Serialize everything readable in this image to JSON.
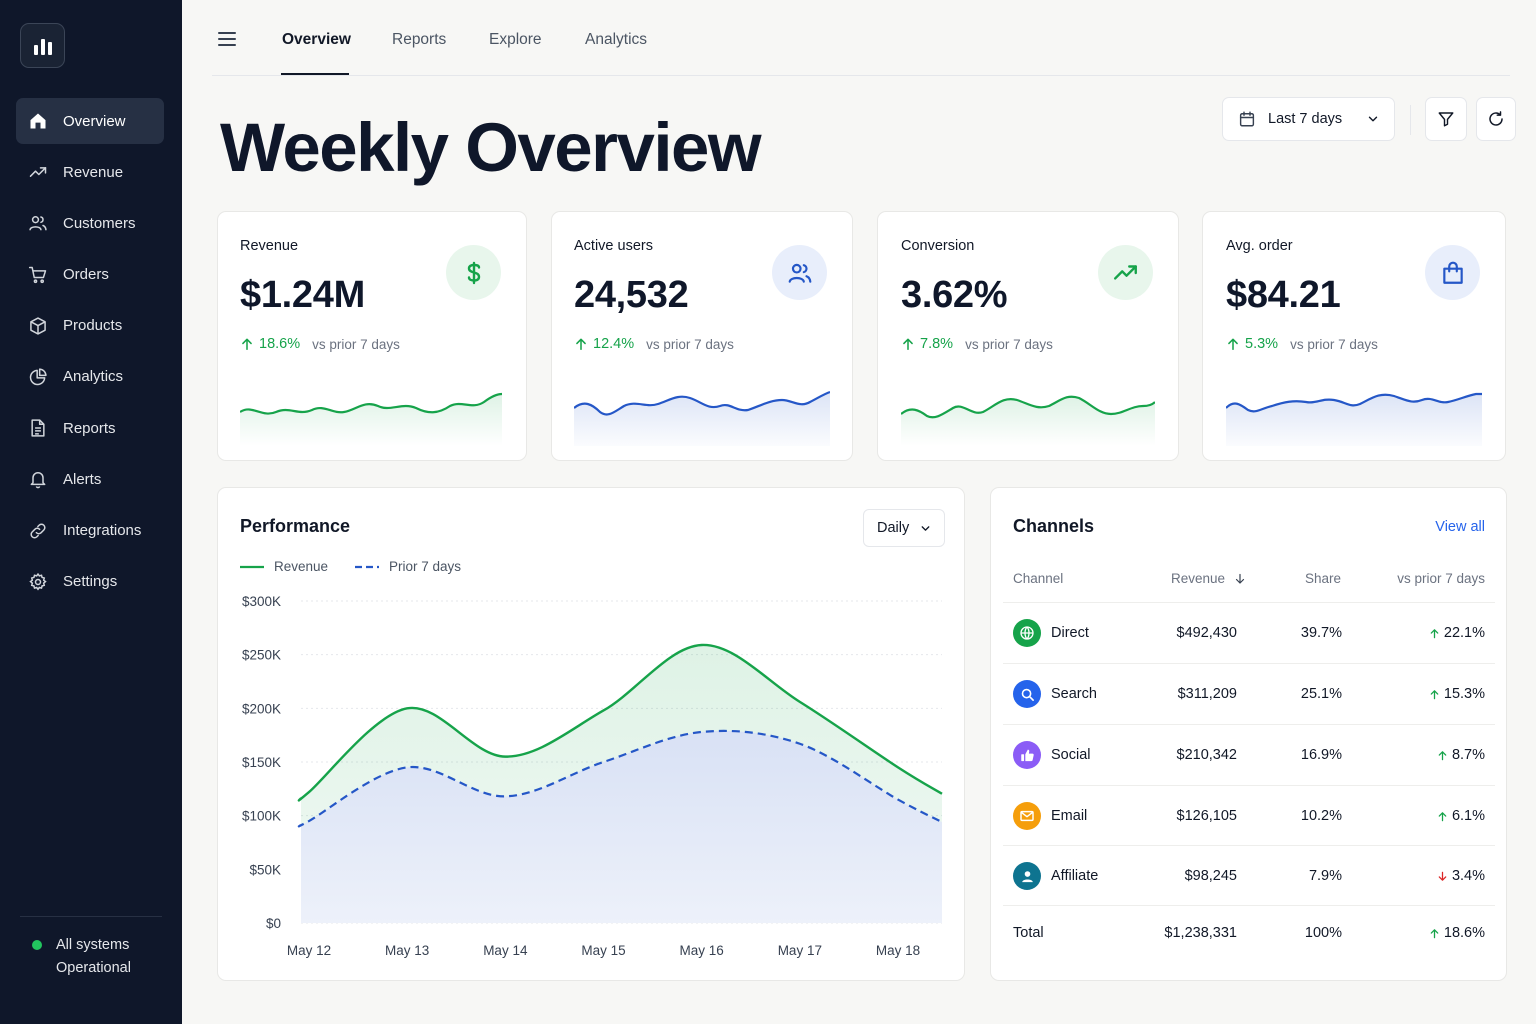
{
  "sidebar": {
    "logo_icon": "bar-chart-icon",
    "items": [
      {
        "label": "Overview",
        "icon": "home-icon",
        "active": true
      },
      {
        "label": "Revenue",
        "icon": "trending-up-icon"
      },
      {
        "label": "Customers",
        "icon": "users-icon"
      },
      {
        "label": "Orders",
        "icon": "cart-icon"
      },
      {
        "label": "Products",
        "icon": "box-icon"
      },
      {
        "label": "Analytics",
        "icon": "pie-chart-icon"
      },
      {
        "label": "Reports",
        "icon": "document-icon"
      },
      {
        "label": "Alerts",
        "icon": "bell-icon"
      },
      {
        "label": "Integrations",
        "icon": "link-icon"
      },
      {
        "label": "Settings",
        "icon": "gear-icon"
      }
    ],
    "status_line1": "All systems",
    "status_line2": "Operational",
    "status_color": "#22c55e"
  },
  "topnav": {
    "tabs": [
      {
        "label": "Overview",
        "active": true
      },
      {
        "label": "Reports"
      },
      {
        "label": "Explore"
      },
      {
        "label": "Analytics"
      }
    ]
  },
  "header": {
    "title": "Weekly Overview",
    "date_range": "Last 7 days"
  },
  "kpis": [
    {
      "label": "Revenue",
      "value": "$1.24M",
      "change": "18.6%",
      "comparison": "vs prior 7 days",
      "icon": "dollar-icon",
      "color": "#16a34a"
    },
    {
      "label": "Active users",
      "value": "24,532",
      "change": "12.4%",
      "comparison": "vs prior 7 days",
      "icon": "users-icon",
      "color": "#2557c7"
    },
    {
      "label": "Conversion",
      "value": "3.62%",
      "change": "7.8%",
      "comparison": "vs prior 7 days",
      "icon": "trending-up-icon",
      "color": "#16a34a"
    },
    {
      "label": "Avg. order",
      "value": "$84.21",
      "change": "5.3%",
      "comparison": "vs prior 7 days",
      "icon": "shopping-bag-icon",
      "color": "#2557c7"
    }
  ],
  "performance": {
    "title": "Performance",
    "granularity": "Daily",
    "legend_current": "Revenue",
    "legend_prior": "Prior 7 days"
  },
  "chart_data": {
    "type": "line",
    "x": [
      "May 12",
      "May 13",
      "May 14",
      "May 15",
      "May 16",
      "May 17",
      "May 18"
    ],
    "ytick_labels": [
      "$300K",
      "$250K",
      "$200K",
      "$150K",
      "$100K",
      "$50K",
      "$0"
    ],
    "ylim": [
      0,
      300000
    ],
    "series": [
      {
        "name": "Revenue",
        "color": "#16a34a",
        "style": "solid",
        "values": [
          122000,
          200000,
          155000,
          198000,
          259000,
          206000,
          145000
        ]
      },
      {
        "name": "Prior 7 days",
        "color": "#2557c7",
        "style": "dashed",
        "values": [
          95000,
          145000,
          118000,
          150000,
          178000,
          167000,
          115000
        ]
      }
    ],
    "grid": true,
    "legend": "top-left"
  },
  "channels": {
    "title": "Channels",
    "view_all": "View all",
    "columns": [
      "Channel",
      "Revenue",
      "Share",
      "vs prior 7 days"
    ],
    "rows": [
      {
        "name": "Direct",
        "revenue": "$492,430",
        "share": "39.7%",
        "change": "22.1%",
        "direction": "up",
        "icon": "globe-icon",
        "color": "#16a34a"
      },
      {
        "name": "Search",
        "revenue": "$311,209",
        "share": "25.1%",
        "change": "15.3%",
        "direction": "up",
        "icon": "search-icon",
        "color": "#2563eb"
      },
      {
        "name": "Social",
        "revenue": "$210,342",
        "share": "16.9%",
        "change": "8.7%",
        "direction": "up",
        "icon": "thumbs-up-icon",
        "color": "#8b5cf6"
      },
      {
        "name": "Email",
        "revenue": "$126,105",
        "share": "10.2%",
        "change": "6.1%",
        "direction": "up",
        "icon": "mail-icon",
        "color": "#f59e0b"
      },
      {
        "name": "Affiliate",
        "revenue": "$98,245",
        "share": "7.9%",
        "change": "3.4%",
        "direction": "down",
        "icon": "user-icon",
        "color": "#0e7490"
      }
    ],
    "total": {
      "label": "Total",
      "revenue": "$1,238,331",
      "share": "100%",
      "change": "18.6%"
    }
  }
}
